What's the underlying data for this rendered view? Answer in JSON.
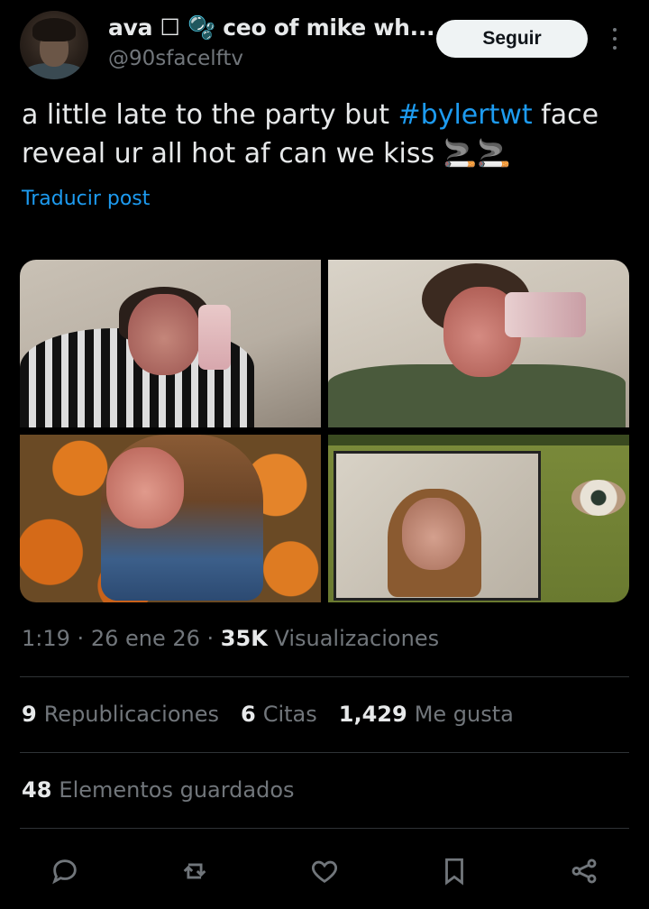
{
  "author": {
    "display_name": "ava ☐ 🫧 ceo of mike wh...",
    "handle": "@90sfacelftv"
  },
  "follow_label": "Seguir",
  "post": {
    "text_before": "a little late to the party but ",
    "hashtag": "#bylertwt",
    "text_after": " face reveal ur all hot af can we kiss 🚬🚬"
  },
  "translate_label": "Traducir post",
  "meta": {
    "time": "1:19",
    "date": "26 ene 26",
    "views_count": "35K",
    "views_label": "Visualizaciones"
  },
  "stats": {
    "reposts_count": "9",
    "reposts_label": "Republicaciones",
    "quotes_count": "6",
    "quotes_label": "Citas",
    "likes_count": "1,429",
    "likes_label": "Me gusta"
  },
  "saved": {
    "count": "48",
    "label": "Elementos guardados"
  },
  "actions": {
    "reply_icon": "reply-icon",
    "repost_icon": "repost-icon",
    "like_icon": "heart-icon",
    "bookmark_icon": "bookmark-icon",
    "share_icon": "share-icon"
  },
  "colors": {
    "accent": "#1d9bf0",
    "text_primary": "#e7e9ea",
    "text_secondary": "#71767b",
    "background": "#000000"
  }
}
